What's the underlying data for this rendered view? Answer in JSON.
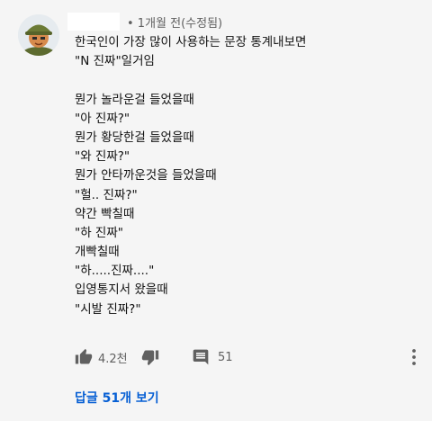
{
  "comment": {
    "author_name": "",
    "timestamp": "• 1개월 전(수정됨)",
    "lines": [
      "한국인이 가장 많이 사용하는 문장 통계내보면",
      "\"N 진짜\"일거임",
      "",
      "뭔가 놀라운걸 들었을때",
      "\"아 진짜?\"",
      "뭔가 황당한걸 들었을때",
      "\"와 진짜?\"",
      "뭔가 안타까운것을 들었을때",
      "\"헐.. 진짜?\"",
      "약간 빡칠때",
      "\"하 진짜\"",
      "개빡칠때",
      "\"하.....진짜....\"",
      "입영통지서 왔을때",
      "\"시발 진짜?\""
    ]
  },
  "actions": {
    "like_count": "4.2천",
    "reply_count": "51"
  },
  "replies_link": "답글 51개 보기",
  "colors": {
    "accent": "#065fd4",
    "icon": "#606060",
    "background": "#f5f5f5"
  }
}
